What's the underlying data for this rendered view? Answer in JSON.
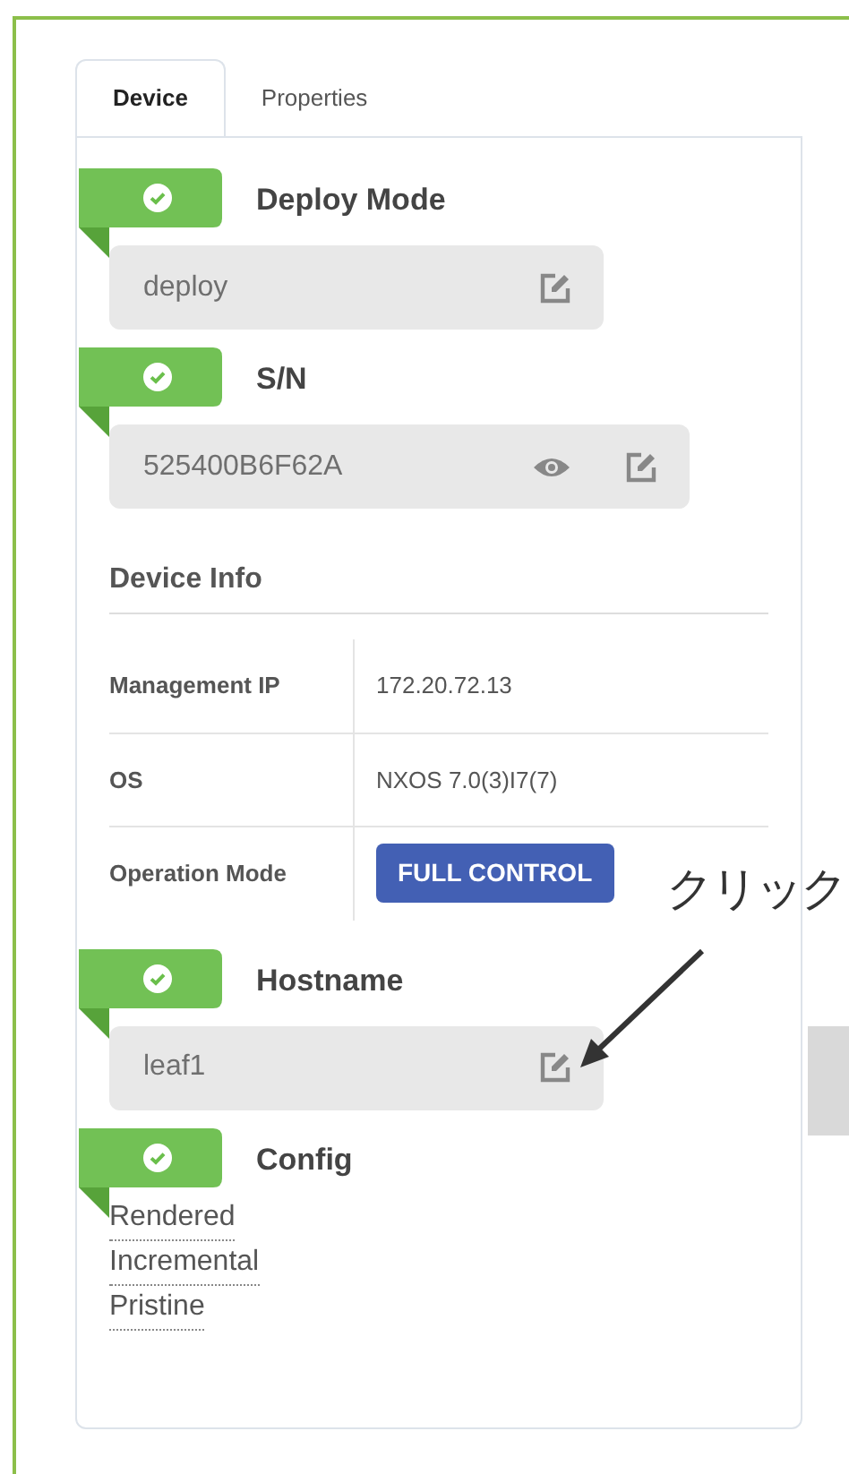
{
  "tabs": [
    {
      "label": "Device",
      "selected": true
    },
    {
      "label": "Properties",
      "selected": false
    }
  ],
  "sections": [
    {
      "kind": "field",
      "title": "Deploy Mode",
      "verified": true,
      "value": "deploy",
      "show_toggle": false
    },
    {
      "kind": "field",
      "title": "S/N",
      "verified": true,
      "value": "525400B6F62A",
      "show_toggle": true
    },
    {
      "kind": "info",
      "title": "Device Info",
      "rows": [
        {
          "kind": "text",
          "label": "Management IP",
          "value": "172.20.72.13"
        },
        {
          "kind": "text",
          "label": "OS",
          "value": "NXOS 7.0(3)I7(7)"
        },
        {
          "kind": "badge",
          "label": "Operation Mode",
          "value": "FULL CONTROL"
        }
      ]
    },
    {
      "kind": "field",
      "title": "Hostname",
      "verified": true,
      "value": "leaf1",
      "show_toggle": false
    },
    {
      "kind": "links",
      "title": "Config",
      "verified": true,
      "links": [
        "Rendered",
        "Incremental",
        "Pristine"
      ]
    }
  ],
  "callout": {
    "text": "クリック"
  }
}
